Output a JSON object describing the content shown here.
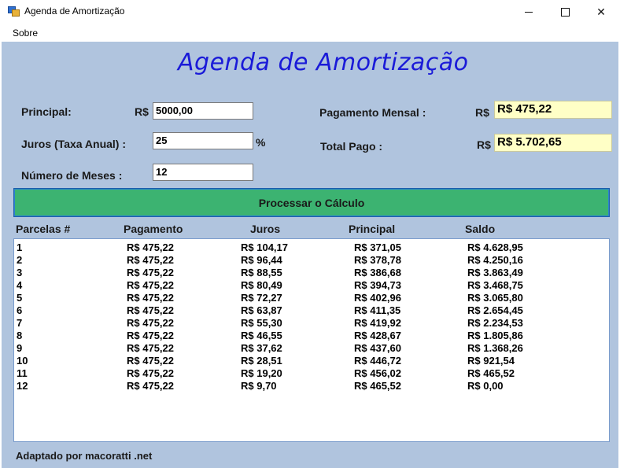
{
  "window": {
    "title": "Agenda de Amortização"
  },
  "menu": {
    "items": [
      "Sobre"
    ]
  },
  "heading": "Agenda de Amortização",
  "form": {
    "principal_label": "Principal:",
    "currency": "R$",
    "principal_value": "5000,00",
    "juros_label": "Juros (Taxa Anual) :",
    "juros_value": "25",
    "percent": "%",
    "meses_label": "Número de Meses :",
    "meses_value": "12",
    "pagamento_label": "Pagamento Mensal :",
    "pagamento_value": "R$ 475,22",
    "total_label": "Total Pago :",
    "total_value": "R$ 5.702,65"
  },
  "process_button": "Processar o Cálculo",
  "table": {
    "headers": [
      "Parcelas #",
      "Pagamento",
      "Juros",
      "Principal",
      "Saldo"
    ],
    "rows": [
      [
        "1",
        "R$ 475,22",
        "R$ 104,17",
        "R$ 371,05",
        "R$ 4.628,95"
      ],
      [
        "2",
        "R$ 475,22",
        "R$ 96,44",
        "R$ 378,78",
        "R$ 4.250,16"
      ],
      [
        "3",
        "R$ 475,22",
        "R$ 88,55",
        "R$ 386,68",
        "R$ 3.863,49"
      ],
      [
        "4",
        "R$ 475,22",
        "R$ 80,49",
        "R$ 394,73",
        "R$ 3.468,75"
      ],
      [
        "5",
        "R$ 475,22",
        "R$ 72,27",
        "R$ 402,96",
        "R$ 3.065,80"
      ],
      [
        "6",
        "R$ 475,22",
        "R$ 63,87",
        "R$ 411,35",
        "R$ 2.654,45"
      ],
      [
        "7",
        "R$ 475,22",
        "R$ 55,30",
        "R$ 419,92",
        "R$ 2.234,53"
      ],
      [
        "8",
        "R$ 475,22",
        "R$ 46,55",
        "R$ 428,67",
        "R$ 1.805,86"
      ],
      [
        "9",
        "R$ 475,22",
        "R$ 37,62",
        "R$ 437,60",
        "R$ 1.368,26"
      ],
      [
        "10",
        "R$ 475,22",
        "R$ 28,51",
        "R$ 446,72",
        "R$ 921,54"
      ],
      [
        "11",
        "R$ 475,22",
        "R$ 19,20",
        "R$ 456,02",
        "R$ 465,52"
      ],
      [
        "12",
        "R$ 475,22",
        "R$ 9,70",
        "R$ 465,52",
        "R$ 0,00"
      ]
    ]
  },
  "footer": "Adaptado por macoratti .net",
  "icons": {
    "app": "app-window-icon",
    "minimize": "minimize-icon",
    "maximize": "maximize-icon",
    "close": "close-icon"
  },
  "colors": {
    "client_bg": "#b0c4de",
    "button_bg": "#3cb371",
    "heading": "#1a1ad8",
    "output_bg": "#ffffc6"
  }
}
